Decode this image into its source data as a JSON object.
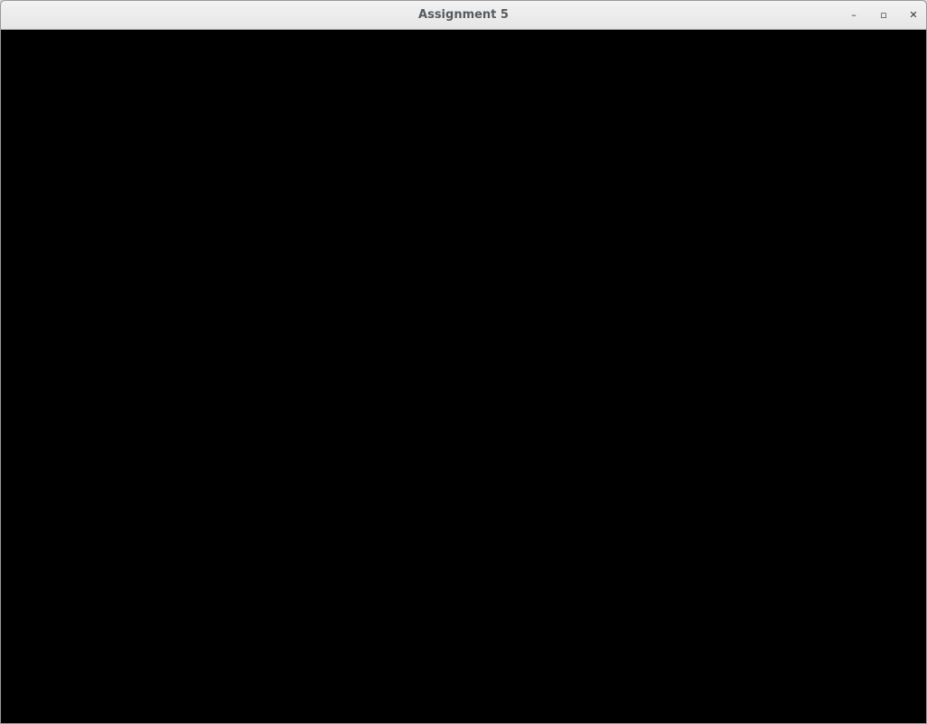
{
  "window": {
    "title": "Assignment 5",
    "controls": {
      "minimize_icon": "minimize-icon",
      "maximize_icon": "maximize-icon",
      "close_icon": "close-icon",
      "minimize_glyph": "–",
      "maximize_glyph": "▫",
      "close_glyph": "✕"
    }
  },
  "viewport": {
    "background": "#000000",
    "wire_color": "#ffffff",
    "render_mode": "wireframe"
  }
}
